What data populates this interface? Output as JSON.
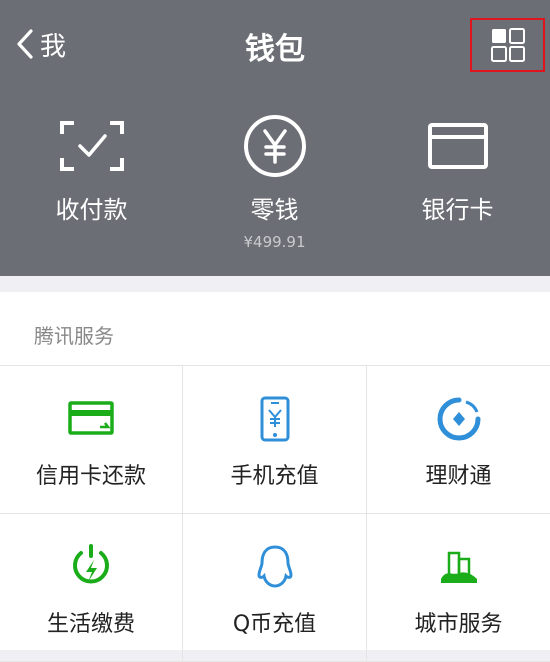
{
  "nav": {
    "back_label": "我",
    "title": "钱包"
  },
  "wallet_items": [
    {
      "label": "收付款",
      "icon": "scan-pay-icon"
    },
    {
      "label": "零钱",
      "sub": "¥499.91",
      "icon": "yuan-coin-icon"
    },
    {
      "label": "银行卡",
      "icon": "bank-card-icon"
    }
  ],
  "services": {
    "title": "腾讯服务",
    "items": [
      {
        "label": "信用卡还款",
        "icon": "credit-card-repay-icon"
      },
      {
        "label": "手机充值",
        "icon": "phone-recharge-icon"
      },
      {
        "label": "理财通",
        "icon": "wealth-icon"
      },
      {
        "label": "生活缴费",
        "icon": "utility-bill-icon"
      },
      {
        "label": "Q币充值",
        "icon": "qq-coin-icon"
      },
      {
        "label": "城市服务",
        "icon": "city-service-icon"
      }
    ]
  },
  "colors": {
    "header_bg": "#6b6e74",
    "accent_green": "#1aad19",
    "accent_blue": "#2f8fd8",
    "highlight_red": "#e0141d"
  }
}
